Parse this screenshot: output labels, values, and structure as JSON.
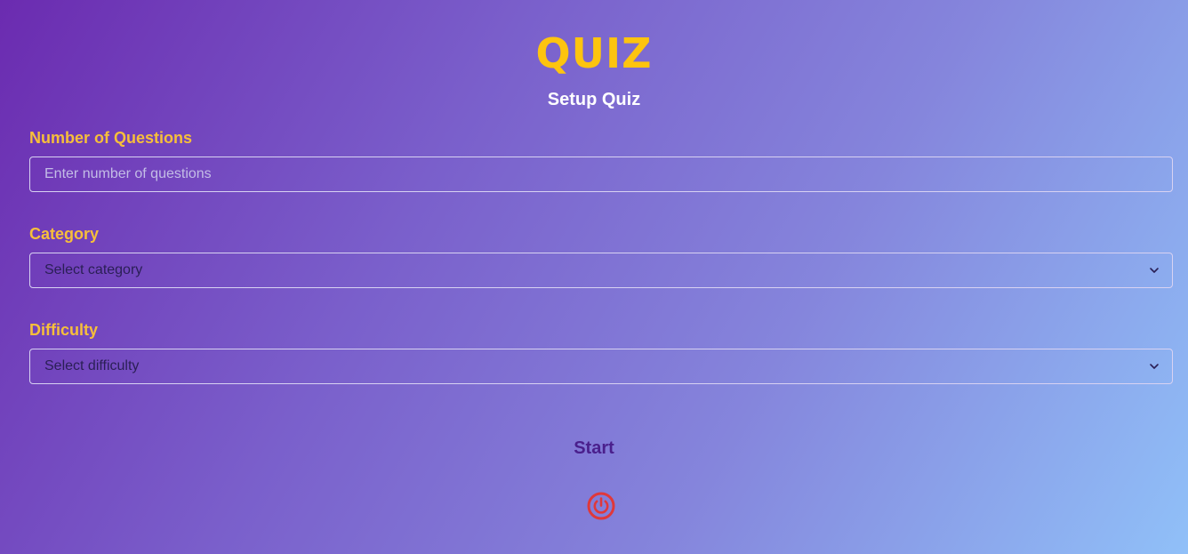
{
  "header": {
    "title": "QUIZ",
    "subtitle": "Setup Quiz"
  },
  "form": {
    "questions": {
      "label": "Number of Questions",
      "placeholder": "Enter number of questions",
      "value": ""
    },
    "category": {
      "label": "Category",
      "selected": "Select category"
    },
    "difficulty": {
      "label": "Difficulty",
      "selected": "Select difficulty"
    },
    "start_label": "Start"
  },
  "icons": {
    "select_arrow": "chevron-down-icon",
    "power": "power-icon"
  },
  "colors": {
    "title": "#fdc40f",
    "label": "#f7bf3a",
    "start": "#4a1f8c",
    "power": "#e0383a"
  }
}
